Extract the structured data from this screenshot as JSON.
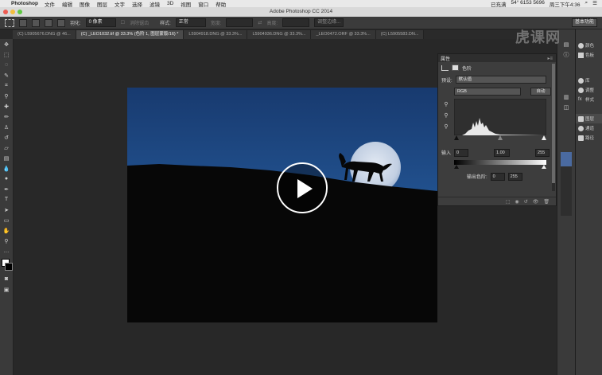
{
  "menubar": {
    "app_name": "Photoshop",
    "items": [
      "文件",
      "编辑",
      "图像",
      "图层",
      "文字",
      "选择",
      "滤镜",
      "3D",
      "视图",
      "窗口",
      "帮助"
    ],
    "status_right": [
      "已充满",
      "54° 6153 5696",
      "周三下午4:36"
    ]
  },
  "window": {
    "title": "Adobe Photoshop CC 2014"
  },
  "options": {
    "feather_label": "羽化:",
    "feather_value": "0 像素",
    "antialias_label": "消除锯齿",
    "style_label": "样式:",
    "style_value": "正常",
    "width_label": "宽度:",
    "height_label": "高度:",
    "refine_edge": "调整边缘...",
    "workspace": "基本功能"
  },
  "tabs": [
    {
      "label": "(C) L5905676.DNG @ 46..."
    },
    {
      "label": "(C) _LEO1032.tif @ 33.3% (色阶 1, 图层蒙版/16) *"
    },
    {
      "label": "L5904918.DNG @ 33.3%..."
    },
    {
      "label": "L5904936.DNG @ 33.3%..."
    },
    {
      "label": "_LEO0472.ORF @ 33.3%..."
    },
    {
      "label": "(C) L5905583.DN..."
    }
  ],
  "panel": {
    "title": "属性",
    "subtitle": "色阶",
    "preset_label": "预设:",
    "preset_value": "默认值",
    "channel_value": "RGB",
    "auto_button": "自动",
    "input_label": "输入",
    "input_black": "0",
    "input_gamma": "1.00",
    "input_white": "255",
    "output_label": "输出色阶:",
    "output_black": "0",
    "output_white": "255"
  },
  "right_panels": [
    {
      "label": "颜色",
      "icon": "swatch-icon"
    },
    {
      "label": "色板",
      "icon": "grid-icon"
    },
    {
      "label": "库",
      "icon": "library-icon"
    },
    {
      "label": "调整",
      "icon": "adjust-icon"
    },
    {
      "label": "样式",
      "icon": "fx-icon"
    },
    {
      "label": "图层",
      "icon": "layers-icon"
    },
    {
      "label": "通道",
      "icon": "channels-icon"
    },
    {
      "label": "路径",
      "icon": "paths-icon"
    }
  ],
  "watermark": "虎课网",
  "colors": {
    "sky_top": "#1b3f78",
    "sky_bottom": "#2b68ad",
    "ground": "#070707",
    "moon": "#c9d6e8"
  }
}
